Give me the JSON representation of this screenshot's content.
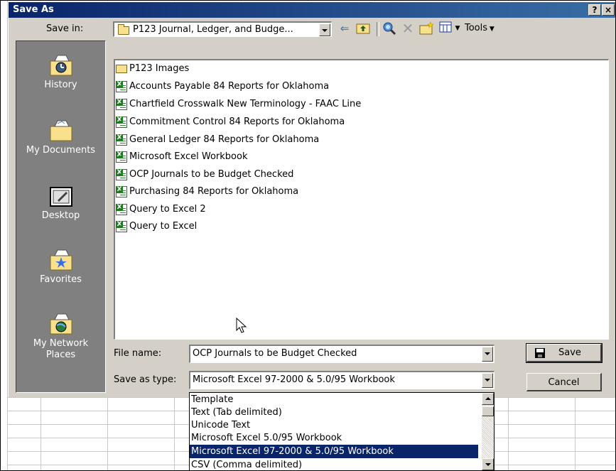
{
  "dialog": {
    "title": "Save As",
    "help_label": "?",
    "close_label": "×"
  },
  "save_in": {
    "label": "Save in:",
    "value": "P123 Journal, Ledger, and Budge..."
  },
  "toolbar": {
    "back_icon": "back-arrow-icon",
    "up_icon": "up-one-level-icon",
    "search_web_icon": "search-web-icon",
    "delete_icon": "delete-icon",
    "new_folder_icon": "new-folder-icon",
    "views_icon": "views-icon",
    "tools_label": "Tools"
  },
  "places": [
    {
      "label": "History",
      "icon": "history-icon"
    },
    {
      "label": "My Documents",
      "icon": "my-documents-icon"
    },
    {
      "label": "Desktop",
      "icon": "desktop-icon"
    },
    {
      "label": "Favorites",
      "icon": "favorites-icon"
    },
    {
      "label": "My Network Places",
      "icon": "network-places-icon"
    }
  ],
  "files": [
    {
      "name": "P123 Images",
      "type": "folder"
    },
    {
      "name": "Accounts Payable 84 Reports for Oklahoma",
      "type": "excel"
    },
    {
      "name": "Chartfield Crosswalk New Terminology - FAAC Line",
      "type": "excel"
    },
    {
      "name": "Commitment Control 84 Reports for Oklahoma",
      "type": "excel"
    },
    {
      "name": "General Ledger 84 Reports for Oklahoma",
      "type": "excel"
    },
    {
      "name": "Microsoft Excel Workbook",
      "type": "excel"
    },
    {
      "name": "OCP Journals to be Budget Checked",
      "type": "excel"
    },
    {
      "name": "Purchasing 84 Reports for Oklahoma",
      "type": "excel"
    },
    {
      "name": "Query to Excel 2",
      "type": "excel"
    },
    {
      "name": "Query to Excel",
      "type": "excel"
    }
  ],
  "file_name": {
    "label": "File name:",
    "value": "OCP Journals to be Budget Checked"
  },
  "save_as_type": {
    "label": "Save as type:",
    "value": "Microsoft Excel 97-2000 & 5.0/95 Workbook",
    "options": [
      "Template",
      "Text (Tab delimited)",
      "Unicode Text",
      "Microsoft Excel 5.0/95 Workbook",
      "Microsoft Excel 97-2000 & 5.0/95 Workbook",
      "CSV (Comma delimited)"
    ],
    "selected_index": 4
  },
  "buttons": {
    "save": "Save",
    "cancel": "Cancel"
  },
  "colors": {
    "titlebar": "#0a246a",
    "dialog_face": "#d4d0c8",
    "selection": "#0a246a",
    "places_bar": "#808080"
  }
}
